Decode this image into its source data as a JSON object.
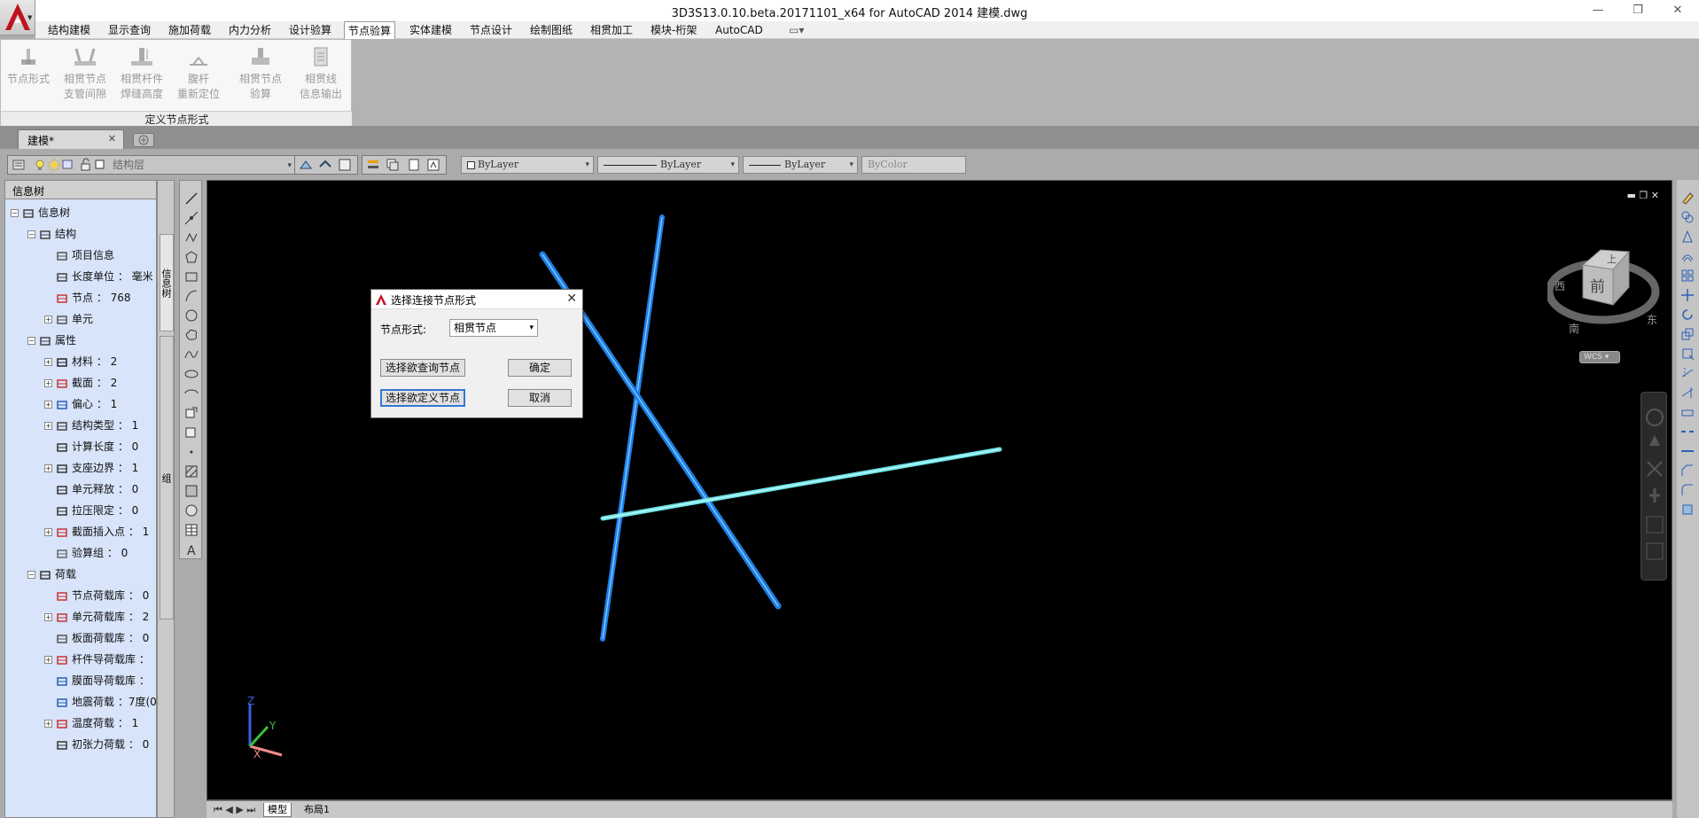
{
  "window": {
    "title": "3D3S13.0.10.beta.20171101_x64 for AutoCAD 2014    建模.dwg",
    "controls": [
      "—",
      "❐",
      "✕"
    ]
  },
  "menu": [
    "结构建模",
    "显示查询",
    "施加荷载",
    "内力分析",
    "设计验算",
    "节点验算",
    "实体建模",
    "节点设计",
    "绘制图纸",
    "相贯加工",
    "模块-桁架",
    "AutoCAD"
  ],
  "menu_active": "节点验算",
  "ribbon": {
    "buttons": [
      {
        "line1": "节点形式",
        "line2": ""
      },
      {
        "line1": "相贯节点",
        "line2": "支管间隙"
      },
      {
        "line1": "相贯杆件",
        "line2": "焊缝高度"
      },
      {
        "line1": "腹杆",
        "line2": "重新定位"
      },
      {
        "line1": "相贯节点",
        "line2": "验算"
      },
      {
        "line1": "相贯线",
        "line2": "信息输出"
      }
    ],
    "group_label": "定义节点形式"
  },
  "doc_tab": {
    "label": "建模*",
    "close": "✕"
  },
  "toolbar": {
    "layer_name": "结构层",
    "color": "ByLayer",
    "linetype": "ByLayer",
    "lineweight": "ByLayer",
    "plotstyle": "ByColor"
  },
  "panel": {
    "title": "信息树",
    "side_tabs": [
      "信息树",
      "组"
    ],
    "tree": [
      {
        "label": "信息树",
        "indent": 0,
        "pm": "-"
      },
      {
        "label": "结构",
        "indent": 1,
        "pm": "-"
      },
      {
        "label": "项目信息",
        "indent": 2,
        "pm": ""
      },
      {
        "label": "长度单位 ： 毫米",
        "indent": 2,
        "pm": ""
      },
      {
        "label": "节点 ： 768",
        "indent": 2,
        "pm": ""
      },
      {
        "label": "单元",
        "indent": 2,
        "pm": "+"
      },
      {
        "label": "属性",
        "indent": 1,
        "pm": "-"
      },
      {
        "label": "材料 ： 2",
        "indent": 2,
        "pm": "+"
      },
      {
        "label": "截面 ： 2",
        "indent": 2,
        "pm": "+"
      },
      {
        "label": "偏心 ： 1",
        "indent": 2,
        "pm": "+"
      },
      {
        "label": "结构类型 ： 1",
        "indent": 2,
        "pm": "+"
      },
      {
        "label": "计算长度 ： 0",
        "indent": 2,
        "pm": ""
      },
      {
        "label": "支座边界 ： 1",
        "indent": 2,
        "pm": "+"
      },
      {
        "label": "单元释放 ： 0",
        "indent": 2,
        "pm": ""
      },
      {
        "label": "拉压限定 ： 0",
        "indent": 2,
        "pm": ""
      },
      {
        "label": "截面插入点 ： 1",
        "indent": 2,
        "pm": "+"
      },
      {
        "label": "验算组 ： 0",
        "indent": 2,
        "pm": ""
      },
      {
        "label": "荷载",
        "indent": 1,
        "pm": "-"
      },
      {
        "label": "节点荷载库 ： 0",
        "indent": 2,
        "pm": ""
      },
      {
        "label": "单元荷载库 ： 2",
        "indent": 2,
        "pm": "+"
      },
      {
        "label": "板面荷载库 ： 0",
        "indent": 2,
        "pm": ""
      },
      {
        "label": "杆件导荷载库 ：",
        "indent": 2,
        "pm": "+"
      },
      {
        "label": "膜面导荷载库 ：",
        "indent": 2,
        "pm": ""
      },
      {
        "label": "地震荷载 ：7度(0",
        "indent": 2,
        "pm": ""
      },
      {
        "label": "温度荷载 ： 1",
        "indent": 2,
        "pm": "+"
      },
      {
        "label": "初张力荷载 ： 0",
        "indent": 2,
        "pm": ""
      }
    ]
  },
  "viewcube": {
    "face": "前",
    "top": "上",
    "left": "西",
    "right": "东",
    "south": "南",
    "wcs": "WCS"
  },
  "ucs": {
    "x": "X",
    "y": "Y",
    "z": "Z"
  },
  "layout_tabs": [
    "模型",
    "布局1"
  ],
  "dialog": {
    "title": "选择连接节点形式",
    "label": "节点形式:",
    "select_value": "相贯节点",
    "btn_query": "选择欲查询节点",
    "btn_define": "选择欲定义节点",
    "btn_ok": "确定",
    "btn_cancel": "取消",
    "close": "✕"
  },
  "colors": {
    "member_blue": "#1e7fe6",
    "member_cyan": "#8ff0f0",
    "panel_bg": "#d7e4f9",
    "viewport_bg": "#000000"
  }
}
